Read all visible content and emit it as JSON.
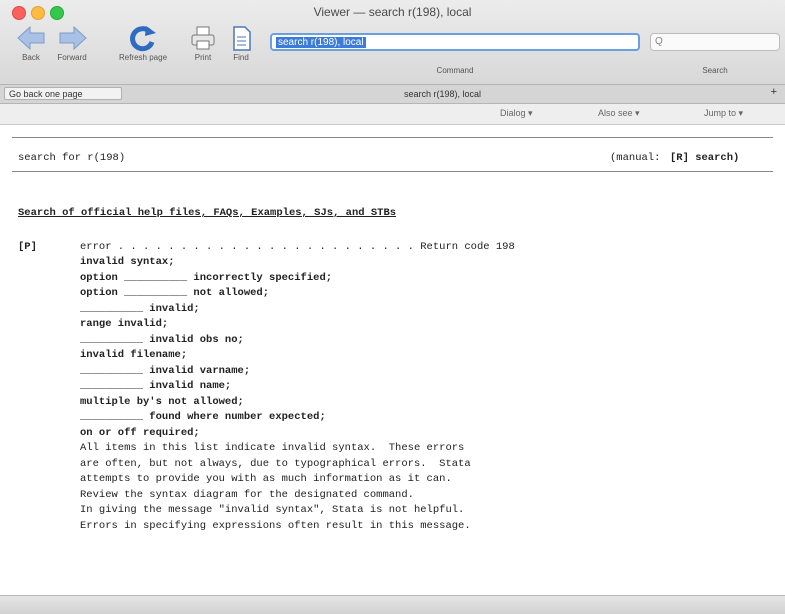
{
  "window": {
    "title": "Viewer — search r(198), local"
  },
  "toolbar": {
    "back_label": "Back",
    "forward_label": "Forward",
    "refresh_label": "Refresh page",
    "print_label": "Print",
    "find_label": "Find",
    "command_value": "search r(198), local",
    "command_label": "Command",
    "search_placeholder": "Q",
    "search_label": "Search"
  },
  "tabbar": {
    "back_tab": "Go back one page",
    "title": "search r(198), local"
  },
  "optbar": {
    "opt1": "Dialog ▾",
    "opt2": "Also see ▾",
    "opt3": "Jump to ▾"
  },
  "content": {
    "header_left": "search for r(198)",
    "header_mid": "(manual:",
    "header_right": "[R] search)",
    "section_title": "Search of official help files, FAQs, Examples, SJs, and STBs",
    "error_tag": "[P]",
    "error_line": "error . . . . . . . . . . . . . . . . . . . . . . . . Return code 198",
    "items": [
      "invalid syntax;",
      "option __________ incorrectly specified;",
      "option __________ not allowed;",
      "__________ invalid;",
      "range invalid;",
      "__________ invalid obs no;",
      "invalid filename;",
      "__________ invalid varname;",
      "__________ invalid name;",
      "multiple by's not allowed;",
      "__________ found where number expected;",
      "on or off required;"
    ],
    "desc": [
      "All items in this list indicate invalid syntax.  These errors",
      "are often, but not always, due to typographical errors.  Stata",
      "attempts to provide you with as much information as it can.",
      "Review the syntax diagram for the designated command.",
      "In giving the message \"invalid syntax\", Stata is not helpful.",
      "Errors in specifying expressions often result in this message."
    ]
  }
}
